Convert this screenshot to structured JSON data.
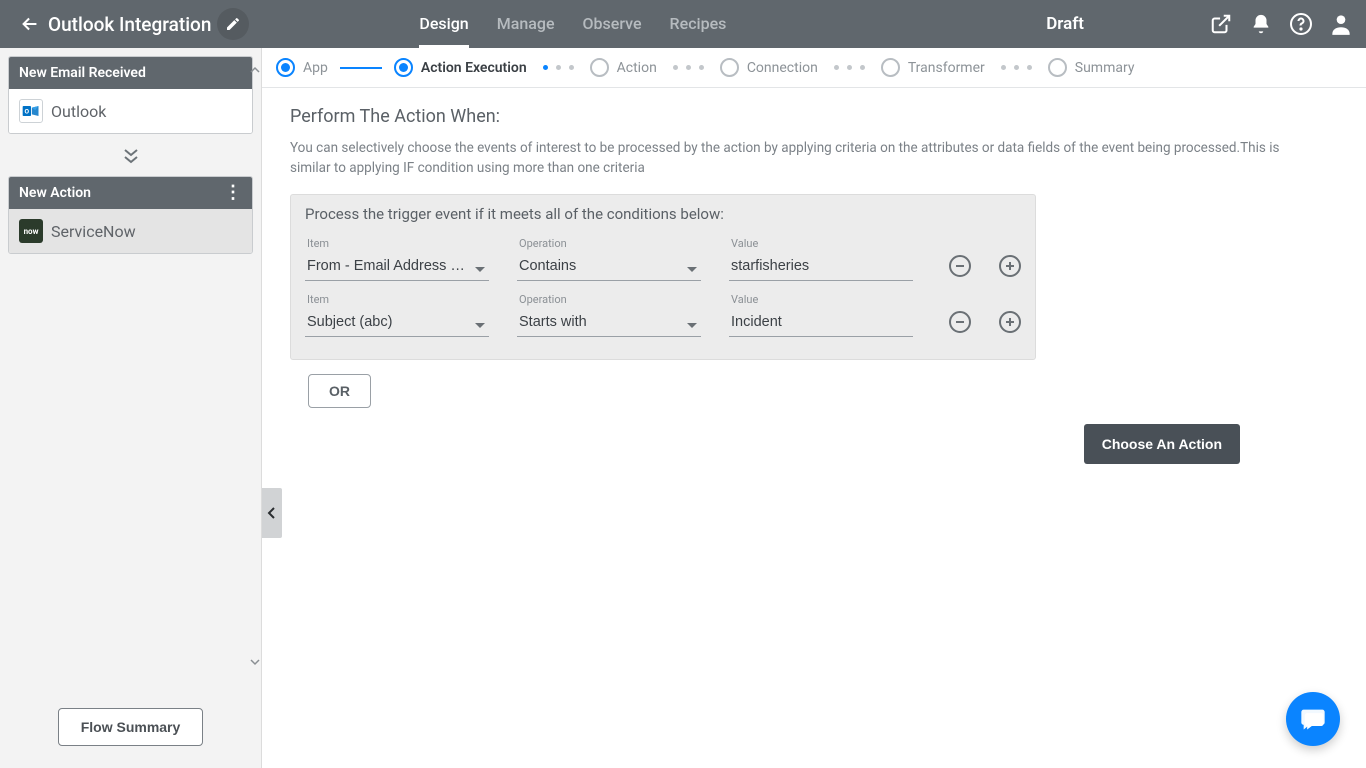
{
  "header": {
    "title": "Outlook Integration",
    "status": "Draft",
    "tabs": [
      {
        "label": "Design",
        "active": true
      },
      {
        "label": "Manage",
        "active": false
      },
      {
        "label": "Observe",
        "active": false
      },
      {
        "label": "Recipes",
        "active": false
      }
    ]
  },
  "sidebar": {
    "cards": [
      {
        "header": "New Email Received",
        "app_label": "Outlook",
        "app": "outlook",
        "selected": false,
        "has_kebab": false
      },
      {
        "header": "New Action",
        "app_label": "ServiceNow",
        "app": "sn",
        "selected": true,
        "has_kebab": true
      }
    ],
    "flow_summary_label": "Flow Summary"
  },
  "stepper": [
    {
      "label": "App",
      "state": "done"
    },
    {
      "label": "Action Execution",
      "state": "done",
      "active": true
    },
    {
      "label": "Action",
      "state": "pending"
    },
    {
      "label": "Connection",
      "state": "pending"
    },
    {
      "label": "Transformer",
      "state": "pending"
    },
    {
      "label": "Summary",
      "state": "pending"
    }
  ],
  "panel": {
    "title": "Perform The Action When:",
    "description": "You can selectively choose the events of interest to be processed by the action by applying criteria on the attributes or data fields of the event being processed.This is similar to applying IF condition using more than one criteria",
    "cond_heading": "Process the trigger event if it meets all of the conditions below:",
    "labels": {
      "item": "Item",
      "operation": "Operation",
      "value": "Value"
    },
    "rows": [
      {
        "item": "From - Email Address …",
        "operation": "Contains",
        "value": "starfisheries"
      },
      {
        "item": "Subject (abc)",
        "operation": "Starts with",
        "value": "Incident"
      }
    ],
    "or_label": "OR",
    "choose_action_label": "Choose An Action"
  }
}
